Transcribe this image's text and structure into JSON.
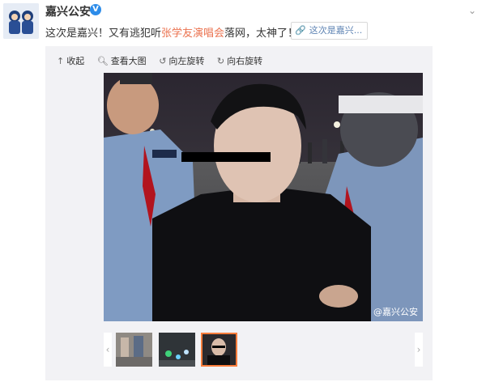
{
  "user": {
    "name": "嘉兴公安",
    "verified_mark": "V"
  },
  "post": {
    "text_before": "这次是嘉兴！又有逃犯听",
    "highlight": "张学友演唱会",
    "text_after": "落网，太神了！",
    "link_card": "这次是嘉兴..."
  },
  "toolbar": {
    "collapse": "收起",
    "view_large": "查看大图",
    "rotate_left": "向左旋转",
    "rotate_right": "向右旋转"
  },
  "photo": {
    "watermark": "@嘉兴公安"
  },
  "colors": {
    "highlight": "#eb7350",
    "link": "#5d83b3",
    "selected_border": "#fa7d3c",
    "verified": "#2d8ce9"
  },
  "icons": [
    "avatar",
    "verified-icon",
    "chevron-down-icon",
    "link-icon",
    "collapse-arrow-icon",
    "search-icon",
    "rotate-left-icon",
    "rotate-right-icon",
    "weibo-icon",
    "chevron-left-icon",
    "chevron-right-icon"
  ]
}
